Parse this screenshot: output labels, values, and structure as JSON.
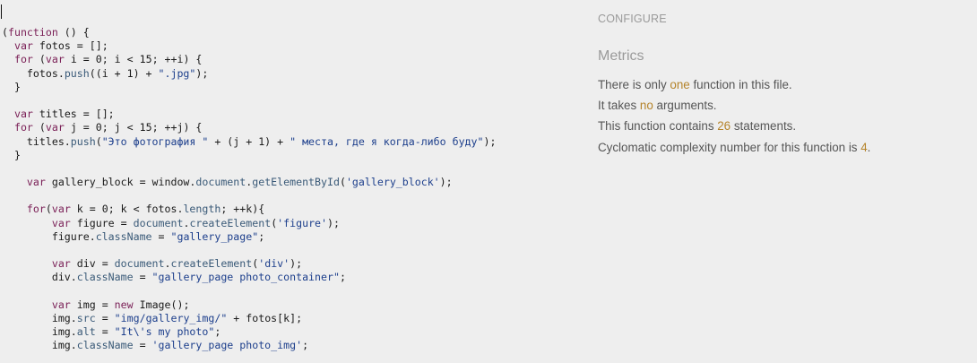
{
  "editor": {
    "lines": [
      "(function () {",
      "  var fotos = [];",
      "  for (var i = 0; i < 15; ++i) {",
      "    fotos.push((i + 1) + \".jpg\");",
      "  }",
      "",
      "  var titles = [];",
      "  for (var j = 0; j < 15; ++j) {",
      "    titles.push(\"Это фотография \" + (j + 1) + \" места, где я когда-либо буду\");",
      "  }",
      "",
      "    var gallery_block = window.document.getElementById('gallery_block');",
      "",
      "    for(var k = 0; k < fotos.length; ++k){",
      "        var figure = document.createElement('figure');",
      "        figure.className = \"gallery_page\";",
      "",
      "        var div = document.createElement('div');",
      "        div.className = \"gallery_page photo_container\";",
      "",
      "        var img = new Image();",
      "        img.src = \"img/gallery_img/\" + fotos[k];",
      "        img.alt = \"It\\'s my photo\";",
      "        img.className = 'gallery_page photo_img';"
    ]
  },
  "panel": {
    "configure_label": "CONFIGURE",
    "metrics_title": "Metrics",
    "metrics": [
      {
        "before": "There is only ",
        "value": "one",
        "after": " function in this file."
      },
      {
        "before": "It takes ",
        "value": "no",
        "after": " arguments."
      },
      {
        "before": "This function contains ",
        "value": "26",
        "after": " statements."
      },
      {
        "before": "Cyclomatic complexity number for this function is ",
        "value": "4",
        "after": "."
      }
    ]
  },
  "colors": {
    "background": "#eeeeee",
    "keyword": "#7a1f56",
    "string": "#1d3f8c",
    "highlight": "#b5842b",
    "muted_text": "#9a9a9a"
  }
}
